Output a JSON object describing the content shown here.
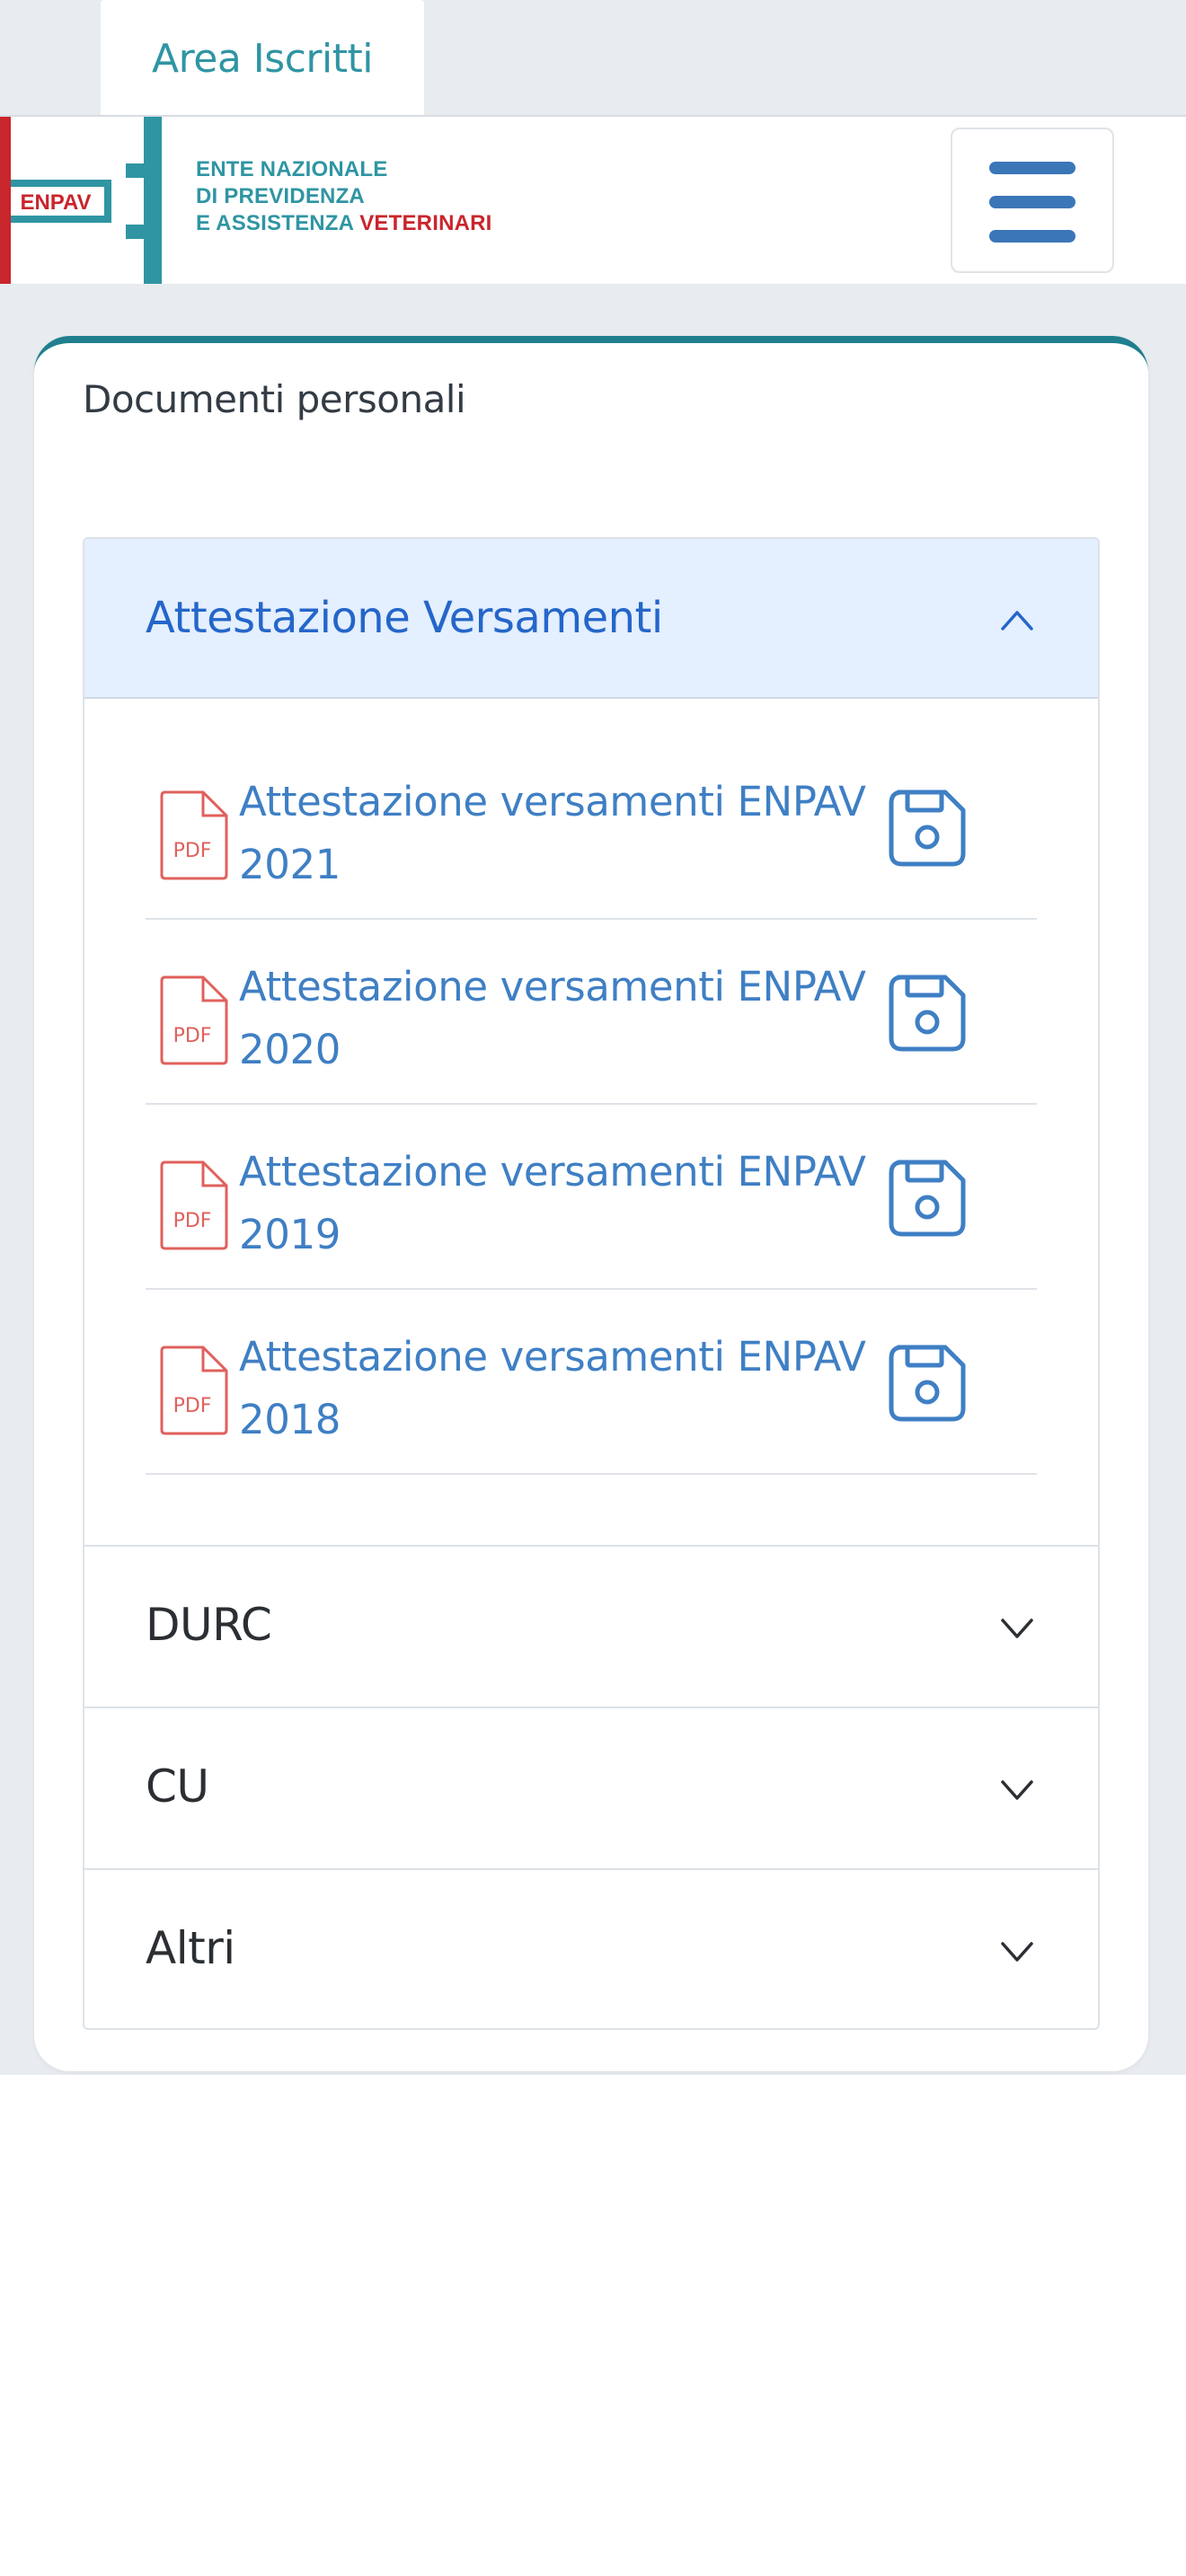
{
  "tabs": {
    "area_iscritti": "Area Iscritti"
  },
  "logo": {
    "mark_text": "ENPAV",
    "line1": "ENTE NAZIONALE",
    "line2": "DI PREVIDENZA",
    "line3_prefix": "E ASSISTENZA ",
    "line3_highlight": "VETERINARI"
  },
  "header": {
    "menu_icon": "hamburger-icon"
  },
  "card": {
    "title": "Documenti personali",
    "sections": [
      {
        "label": "Attestazione Versamenti",
        "expanded": true,
        "documents": [
          {
            "line1": "Attestazione versamenti ENPAV",
            "line2": "2021",
            "type_label": "PDF"
          },
          {
            "line1": "Attestazione versamenti ENPAV",
            "line2": "2020",
            "type_label": "PDF"
          },
          {
            "line1": "Attestazione versamenti ENPAV",
            "line2": "2019",
            "type_label": "PDF"
          },
          {
            "line1": "Attestazione versamenti ENPAV",
            "line2": "2018",
            "type_label": "PDF"
          }
        ]
      },
      {
        "label": "DURC",
        "expanded": false
      },
      {
        "label": "CU",
        "expanded": false
      },
      {
        "label": "Altri",
        "expanded": false
      }
    ]
  },
  "colors": {
    "brand_teal": "#2f95a3",
    "brand_red": "#c9252c",
    "link_blue": "#3f7fc4",
    "active_header_bg": "#e4efff",
    "pdf_red": "#e0605c"
  }
}
